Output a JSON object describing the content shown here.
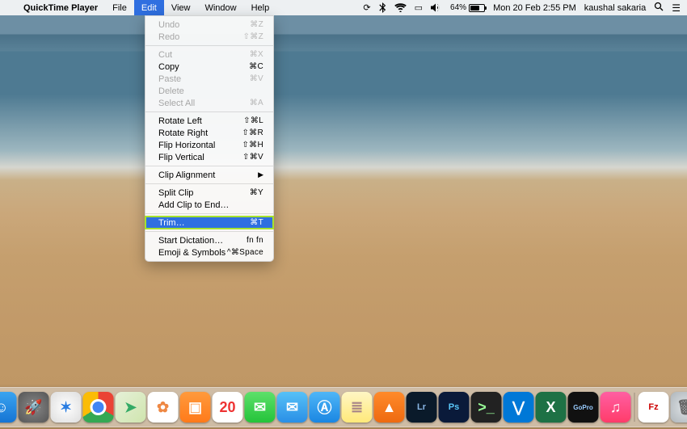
{
  "menubar": {
    "app_name": "QuickTime Player",
    "items": [
      "File",
      "Edit",
      "View",
      "Window",
      "Help"
    ],
    "active_index": 1,
    "status": {
      "battery_percent": "64%",
      "clock": "Mon 20 Feb  2:55 PM",
      "user": "kaushal sakaria"
    }
  },
  "edit_menu": {
    "groups": [
      [
        {
          "label": "Undo",
          "shortcut": "⌘Z",
          "disabled": true
        },
        {
          "label": "Redo",
          "shortcut": "⇧⌘Z",
          "disabled": true
        }
      ],
      [
        {
          "label": "Cut",
          "shortcut": "⌘X",
          "disabled": true
        },
        {
          "label": "Copy",
          "shortcut": "⌘C",
          "disabled": false
        },
        {
          "label": "Paste",
          "shortcut": "⌘V",
          "disabled": true
        },
        {
          "label": "Delete",
          "shortcut": "",
          "disabled": true
        },
        {
          "label": "Select All",
          "shortcut": "⌘A",
          "disabled": true
        }
      ],
      [
        {
          "label": "Rotate Left",
          "shortcut": "⇧⌘L",
          "disabled": false
        },
        {
          "label": "Rotate Right",
          "shortcut": "⇧⌘R",
          "disabled": false
        },
        {
          "label": "Flip Horizontal",
          "shortcut": "⇧⌘H",
          "disabled": false
        },
        {
          "label": "Flip Vertical",
          "shortcut": "⇧⌘V",
          "disabled": false
        }
      ],
      [
        {
          "label": "Clip Alignment",
          "shortcut": "",
          "disabled": false,
          "submenu": true
        }
      ],
      [
        {
          "label": "Split Clip",
          "shortcut": "⌘Y",
          "disabled": false
        },
        {
          "label": "Add Clip to End…",
          "shortcut": "",
          "disabled": false
        }
      ],
      [
        {
          "label": "Trim…",
          "shortcut": "⌘T",
          "disabled": false,
          "highlighted": true
        }
      ],
      [
        {
          "label": "Start Dictation…",
          "shortcut": "fn fn",
          "disabled": false
        },
        {
          "label": "Emoji & Symbols",
          "shortcut": "^⌘Space",
          "disabled": false
        }
      ]
    ]
  },
  "dock": {
    "items": [
      {
        "name": "finder",
        "glyph": "☺"
      },
      {
        "name": "launchpad",
        "glyph": "🚀"
      },
      {
        "name": "safari",
        "glyph": "✶"
      },
      {
        "name": "chrome",
        "glyph": ""
      },
      {
        "name": "maps",
        "glyph": "➤"
      },
      {
        "name": "photos",
        "glyph": "✿"
      },
      {
        "name": "ibooks",
        "glyph": "▣"
      },
      {
        "name": "calendar",
        "glyph": "20"
      },
      {
        "name": "messages",
        "glyph": "✉"
      },
      {
        "name": "mail",
        "glyph": "✉"
      },
      {
        "name": "appstore",
        "glyph": "Ⓐ"
      },
      {
        "name": "notes",
        "glyph": "≣"
      },
      {
        "name": "vlc",
        "glyph": "▲"
      },
      {
        "name": "lightroom",
        "glyph": "Lr"
      },
      {
        "name": "photoshop",
        "glyph": "Ps"
      },
      {
        "name": "terminal",
        "glyph": ">_"
      },
      {
        "name": "vscode",
        "glyph": "⋁"
      },
      {
        "name": "excel",
        "glyph": "X"
      },
      {
        "name": "gopro",
        "glyph": "GoPro"
      },
      {
        "name": "applemusic",
        "glyph": "♫"
      }
    ],
    "right_items": [
      {
        "name": "filezilla",
        "glyph": "Fz"
      },
      {
        "name": "trash",
        "glyph": "🗑"
      }
    ]
  }
}
